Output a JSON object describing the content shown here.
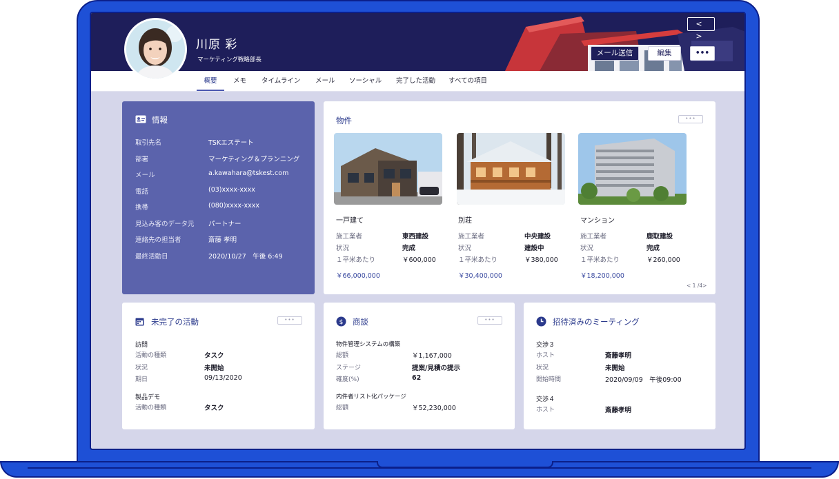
{
  "header": {
    "name": "川原 彩",
    "role": "マーケティング戦略部長",
    "buttons": {
      "email": "メール送信",
      "edit": "編集",
      "more": "•••"
    },
    "pager": "< >"
  },
  "tabs": [
    "概要",
    "メモ",
    "タイムライン",
    "メール",
    "ソーシャル",
    "完了した活動",
    "すべての項目"
  ],
  "info": {
    "title": "情報",
    "rows": [
      {
        "label": "取引先名",
        "value": "TSKエステート"
      },
      {
        "label": "部署",
        "value": "マーケティング＆プランニング"
      },
      {
        "label": "メール",
        "value": "a.kawahara@tskest.com"
      },
      {
        "label": "電話",
        "value": "(03)xxxx-xxxx"
      },
      {
        "label": "携帯",
        "value": "(080)xxxx-xxxx"
      },
      {
        "label": "見込み客のデータ元",
        "value": "パートナー"
      },
      {
        "label": "連絡先の担当者",
        "value": "斎藤 孝明"
      },
      {
        "label": "最終活動日",
        "value": "2020/10/27　午後 6:49"
      }
    ]
  },
  "properties": {
    "title": "物件",
    "more": "•••",
    "page": "< 1 /4>",
    "items": [
      {
        "name": "一戸建て",
        "builder_label": "施工業者",
        "builder": "東西建設",
        "status_label": "状況",
        "status": "完成",
        "unit_label": "１平米あたり",
        "unit_price": "￥600,000",
        "total": "￥66,000,000"
      },
      {
        "name": "別荘",
        "builder_label": "施工業者",
        "builder": "中央建設",
        "status_label": "状況",
        "status": "建設中",
        "unit_label": "１平米あたり",
        "unit_price": "￥380,000",
        "total": "￥30,400,000"
      },
      {
        "name": "マンション",
        "builder_label": "施工業者",
        "builder": "鹿取建設",
        "status_label": "状況",
        "status": "完成",
        "unit_label": "１平米あたり",
        "unit_price": "￥260,000",
        "total": "￥18,200,000"
      }
    ]
  },
  "activities": {
    "title": "未完了の活動",
    "more": "•••",
    "a1": {
      "title": "訪問",
      "type_label": "活動の種類",
      "type": "タスク",
      "status_label": "状況",
      "status": "未開始",
      "date_label": "期日",
      "date": "09/13/2020"
    },
    "a2": {
      "title": "製品デモ",
      "type_label": "活動の種類",
      "type": "タスク"
    }
  },
  "deals": {
    "title": "商談",
    "more": "•••",
    "d1": {
      "title": "物件管理システムの構築",
      "total_label": "総額",
      "total": "￥1,167,000",
      "stage_label": "ステージ",
      "stage": "提案/見積の提示",
      "prob_label": "確度(%)",
      "prob": "62"
    },
    "d2": {
      "title": "内件者リスト化パッケージ",
      "total_label": "総額",
      "total": "￥52,230,000"
    }
  },
  "meetings": {
    "title": "招待済みのミーティング",
    "m1": {
      "title": "交渉３",
      "host_label": "ホスト",
      "host": "斎藤孝明",
      "status_label": "状況",
      "status": "未開始",
      "start_label": "開始時間",
      "start": "2020/09/09　午後09:00"
    },
    "m2": {
      "title": "交渉４",
      "host_label": "ホスト",
      "host": "斎藤孝明"
    }
  },
  "colors": {
    "navy": "#1e1e5a",
    "accent": "#5b63ac",
    "laptop": "#1e50d6",
    "bg": "#d5d6ea"
  }
}
